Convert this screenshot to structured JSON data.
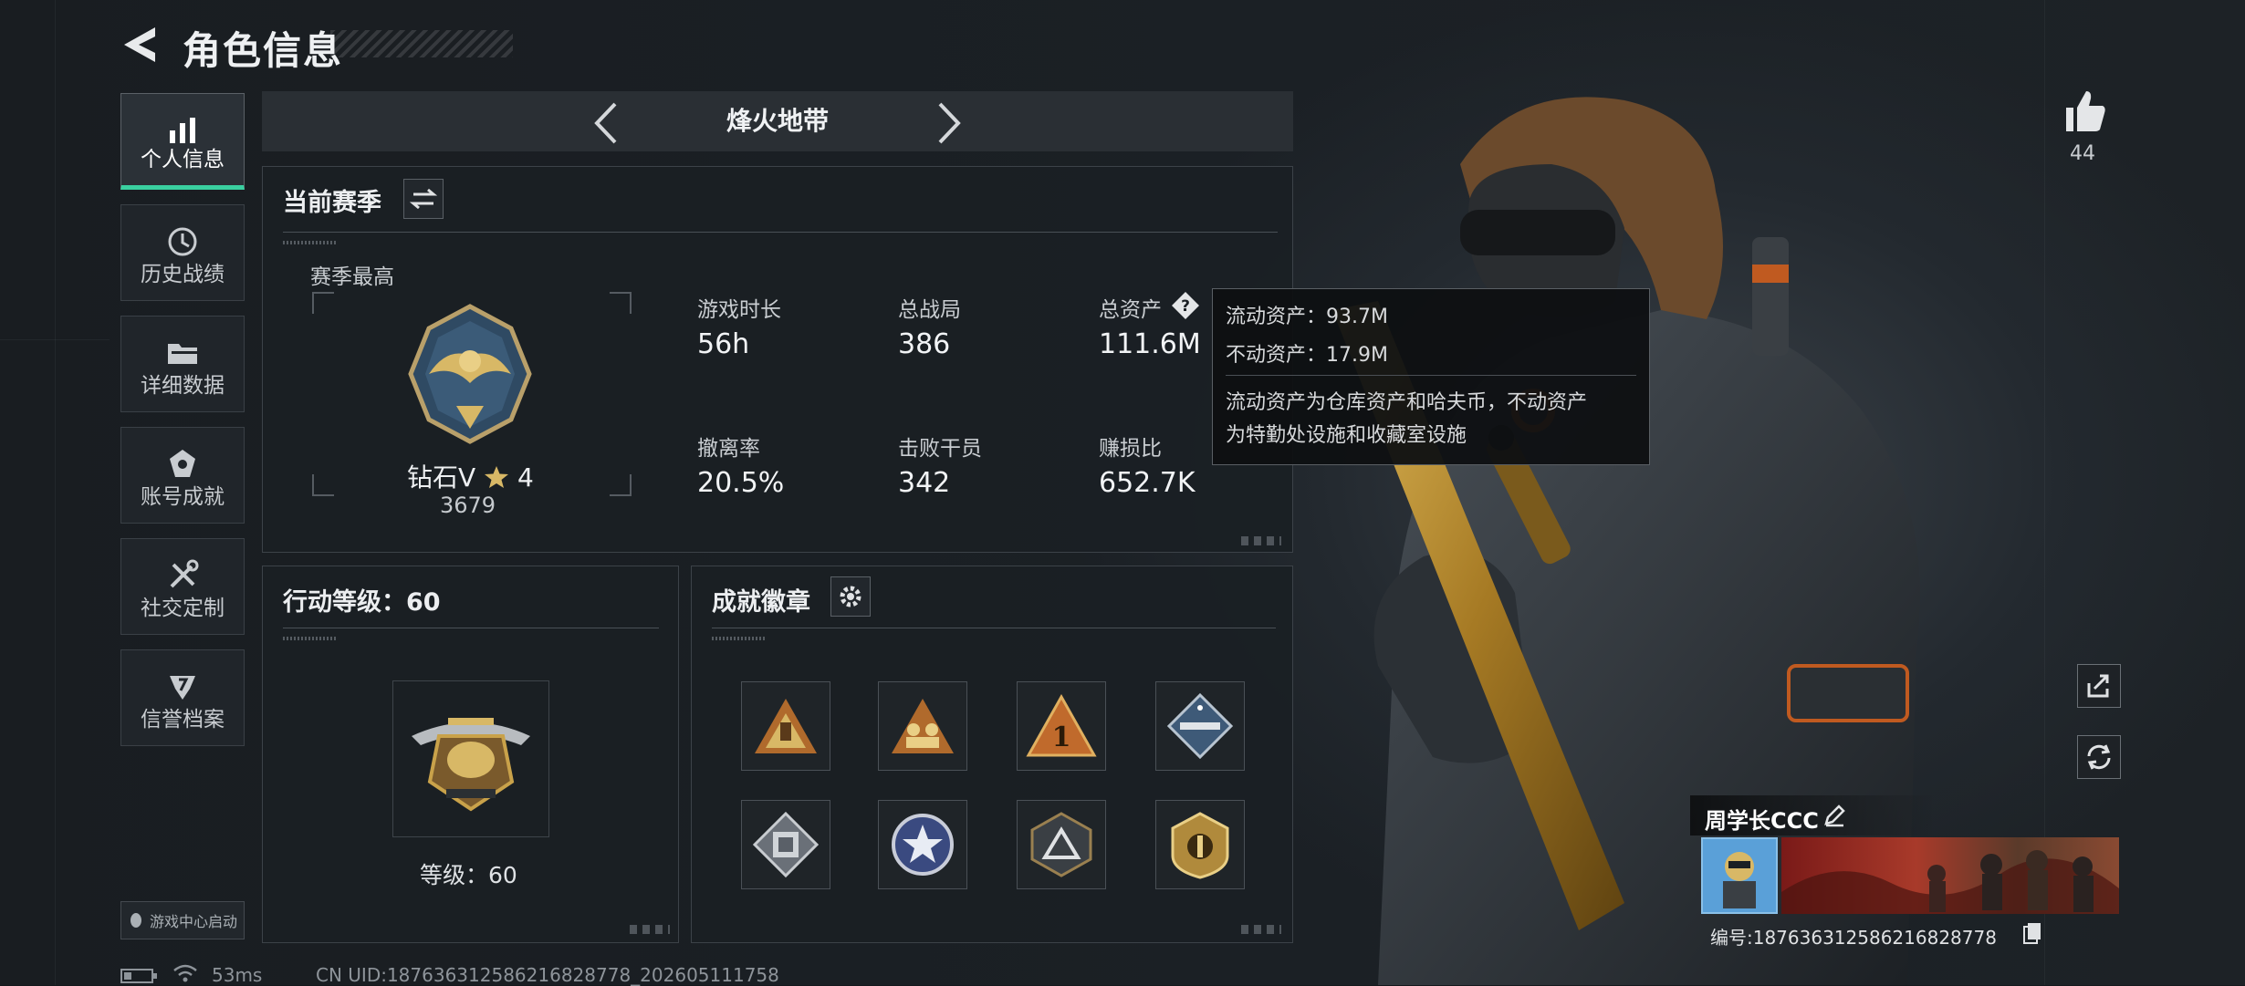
{
  "header": {
    "title": "角色信息"
  },
  "sidebar": {
    "items": [
      {
        "label": "个人信息",
        "icon": "bar-chart-icon",
        "active": true
      },
      {
        "label": "历史战绩",
        "icon": "history-clock-icon",
        "active": false
      },
      {
        "label": "详细数据",
        "icon": "folder-icon",
        "active": false
      },
      {
        "label": "账号成就",
        "icon": "achievement-medal-icon",
        "active": false
      },
      {
        "label": "社交定制",
        "icon": "tools-icon",
        "active": false
      },
      {
        "label": "信誉档案",
        "icon": "reputation-shield-icon",
        "active": false
      }
    ],
    "launch_label": "游戏中心启动"
  },
  "mode": {
    "title": "烽火地带"
  },
  "season": {
    "title": "当前赛季",
    "best_label": "赛季最高",
    "rank_name": "钻石V",
    "rank_stars": "4",
    "rank_score": "3679",
    "stats": [
      {
        "label": "游戏时长",
        "value": "56h"
      },
      {
        "label": "总战局",
        "value": "386"
      },
      {
        "label": "总资产",
        "value": "111.6M"
      },
      {
        "label": "撤离率",
        "value": "20.5%"
      },
      {
        "label": "击败干员",
        "value": "342"
      },
      {
        "label": "赚损比",
        "value": "652.7K"
      }
    ]
  },
  "tooltip": {
    "liquid": "流动资产：93.7M",
    "fixed": "不动资产：17.9M",
    "desc_line1": "流动资产为仓库资产和哈夫币，不动资产",
    "desc_line2": "为特勤处设施和收藏室设施"
  },
  "action_level": {
    "title": "行动等级：60",
    "level_text": "等级：60"
  },
  "achievements": {
    "title": "成就徽章",
    "badges": [
      "hand-sign-badge-icon",
      "soldiers-badge-icon",
      "number-one-badge-icon",
      "missile-badge-icon",
      "cube-badge-icon",
      "star-shield-badge-icon",
      "triangle-badge-icon",
      "round-shield-badge-icon"
    ]
  },
  "likes": {
    "count": "44"
  },
  "profile": {
    "name": "周学长CCC",
    "uid_label": "编号:187636312586216828778"
  },
  "footer": {
    "ping": "53ms",
    "uid": "CN UID:187636312586216828778_202605111758"
  },
  "colors": {
    "accent": "#3ad0a0",
    "gold": "#c9a24a",
    "panel_bg": "#1a1f24"
  }
}
